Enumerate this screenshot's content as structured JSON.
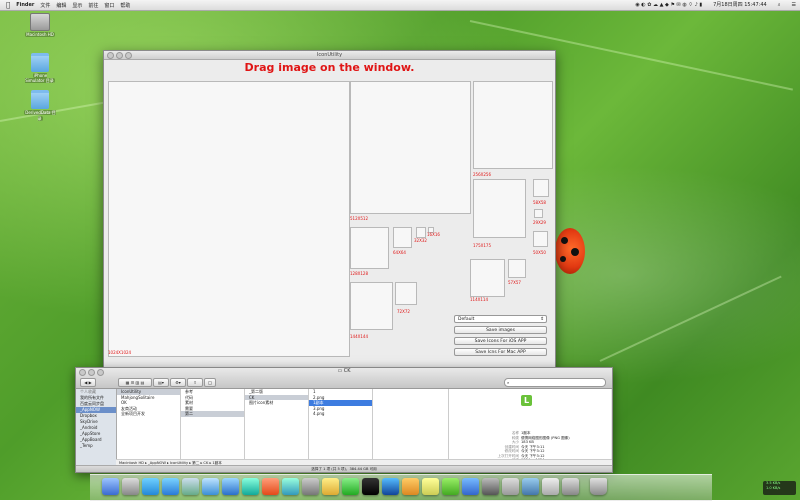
{
  "menubar": {
    "items": [
      "Finder",
      "文件",
      "编辑",
      "显示",
      "前往",
      "窗口",
      "帮助"
    ],
    "clock": "7月18日周四 15:47:44"
  },
  "desktop_icons": [
    {
      "label": "Macintosh HD",
      "icon": "hard-drive-icon"
    },
    {
      "label": "iPhone Simulator 目录",
      "icon": "folder-icon"
    },
    {
      "label": "DerivedData 目录",
      "icon": "folder-icon"
    }
  ],
  "app_window": {
    "title": "IconUtility",
    "heading": "Drag image on the window.",
    "boxes": [
      {
        "label": "1024X1024"
      },
      {
        "label": "512X512"
      },
      {
        "label": "256X256"
      },
      {
        "label": "128X128"
      },
      {
        "label": "64X64"
      },
      {
        "label": "32X32"
      },
      {
        "label": "16X16"
      },
      {
        "label": "144X144"
      },
      {
        "label": "72X72"
      },
      {
        "label": "175X175"
      },
      {
        "label": "58X58"
      },
      {
        "label": "29X29"
      },
      {
        "label": "50X50"
      },
      {
        "label": "114X114"
      },
      {
        "label": "57X57"
      }
    ],
    "select_value": "Default",
    "buttons": [
      "Save images",
      "Save Icons For iOS APP",
      "Save Icns For Mac APP"
    ]
  },
  "finder": {
    "title": "CK",
    "sidebar": {
      "header": "个人收藏",
      "items": [
        "我的所有文件",
        "百度云同步盘",
        "_AppNOW",
        "Dropbox",
        "SkyDrive",
        "_Android",
        "_AppStore",
        "_AppBoard",
        "_Temp"
      ],
      "selected": "_AppNOW"
    },
    "columns": [
      {
        "items": [
          "IconUtility",
          "MahjongSolitaire",
          "OK",
          "友商活动",
          "全新项目开发"
        ],
        "selected": "IconUtility"
      },
      {
        "items": [
          "参考",
          "代码",
          "素材",
          "需要",
          "第二"
        ],
        "selected": "第二"
      },
      {
        "items": [
          "_第二版",
          "CK",
          "图片icon素材"
        ],
        "selected": "CK"
      },
      {
        "items": [
          "1",
          "2.png",
          "1副本",
          "3.png",
          "4.png"
        ],
        "selected": "1副本"
      }
    ],
    "preview": {
      "icon_letter": "L",
      "rows": [
        {
          "k": "名称",
          "v": "1副本"
        },
        {
          "k": "种类",
          "v": "便携网络图形图像 (PNG 图像)"
        },
        {
          "k": "大小",
          "v": "183 KB"
        },
        {
          "k": "创建时间",
          "v": "今天 下午3:11"
        },
        {
          "k": "修改时间",
          "v": "今天 下午3:12"
        },
        {
          "k": "上次打开时间",
          "v": "今天 下午3:12"
        },
        {
          "k": "尺寸",
          "v": "1024 × 1024"
        }
      ]
    },
    "path": "Macintosh HD ▸ _AppNOW ▸ IconUtility ▸ 第二 ▸ CK ▸ 1副本",
    "status": "选择了 1 项 (共 5 项)，384.44 GB 可用"
  },
  "netmon": {
    "up": "3.5 KB/s",
    "down": "1.0 KB/s"
  }
}
